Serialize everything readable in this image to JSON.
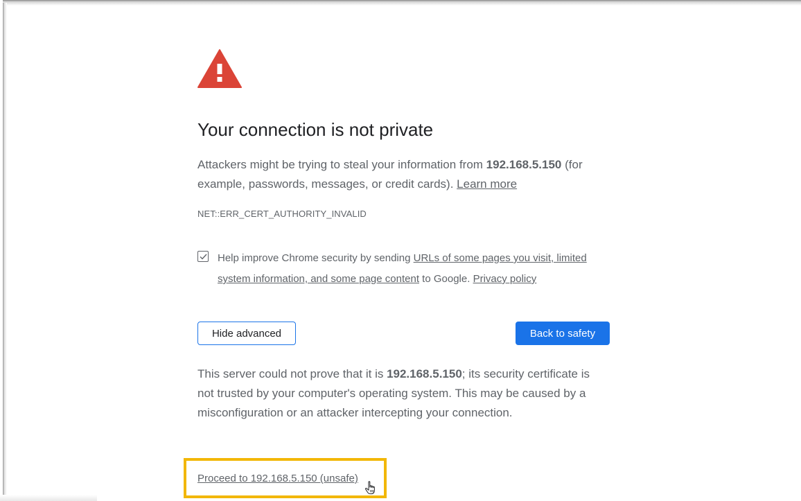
{
  "page": {
    "title": "Your connection is not private",
    "description": {
      "prefix": "Attackers might be trying to steal your information from ",
      "host": "192.168.5.150",
      "suffix": " (for example, passwords, messages, or credit cards). ",
      "learn_more": "Learn more"
    },
    "error_code": "NET::ERR_CERT_AUTHORITY_INVALID"
  },
  "optin": {
    "checked": true,
    "text_1": "Help improve Chrome security by sending ",
    "link_1": "URLs of some pages you visit, limited system information, and some page content",
    "text_2": " to Google. ",
    "privacy_link": "Privacy policy"
  },
  "buttons": {
    "hide_advanced": "Hide advanced",
    "back_to_safety": "Back to safety"
  },
  "details": {
    "prefix": "This server could not prove that it is ",
    "host": "192.168.5.150",
    "suffix": "; its security certificate is not trusted by your computer's operating system. This may be caused by a misconfiguration or an attacker intercepting your connection."
  },
  "proceed": {
    "label": "Proceed to 192.168.5.150 (unsafe)"
  },
  "colors": {
    "warning_red": "#db4437",
    "primary_blue": "#1a73e8",
    "highlight": "#f2b707",
    "text_secondary": "#5f6368"
  },
  "icons": {
    "warning": "warning-triangle-icon",
    "checkbox": "checkmark-icon",
    "cursor": "hand-pointer-icon"
  }
}
